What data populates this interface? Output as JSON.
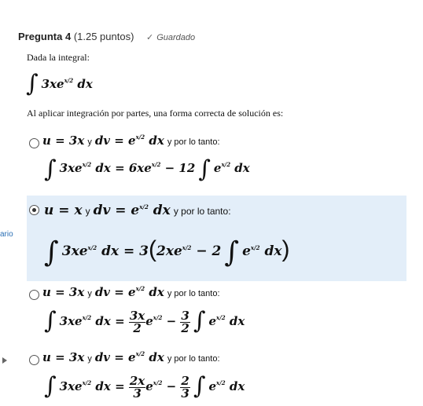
{
  "question": {
    "label": "Pregunta 4",
    "points": "(1.25 puntos)",
    "status": "Guardado",
    "prompt": "Dada la integral:",
    "instruction": "Al aplicar integración por partes, una forma correcta de solución es:"
  },
  "sidebar": {
    "cut_text": "ario"
  },
  "options": [
    {
      "selected": false,
      "connector": "y",
      "tail": "y por lo tanto:"
    },
    {
      "selected": true,
      "connector": "y",
      "tail": "y por lo tanto:"
    },
    {
      "selected": false,
      "connector": "y",
      "tail": "y por lo tanto:"
    },
    {
      "selected": false,
      "connector": "y",
      "tail": "y por lo tanto:"
    }
  ],
  "icons": {
    "saved": "checkmark-icon",
    "radio": "radio-button-icon",
    "nav": "triangle-right-icon"
  }
}
